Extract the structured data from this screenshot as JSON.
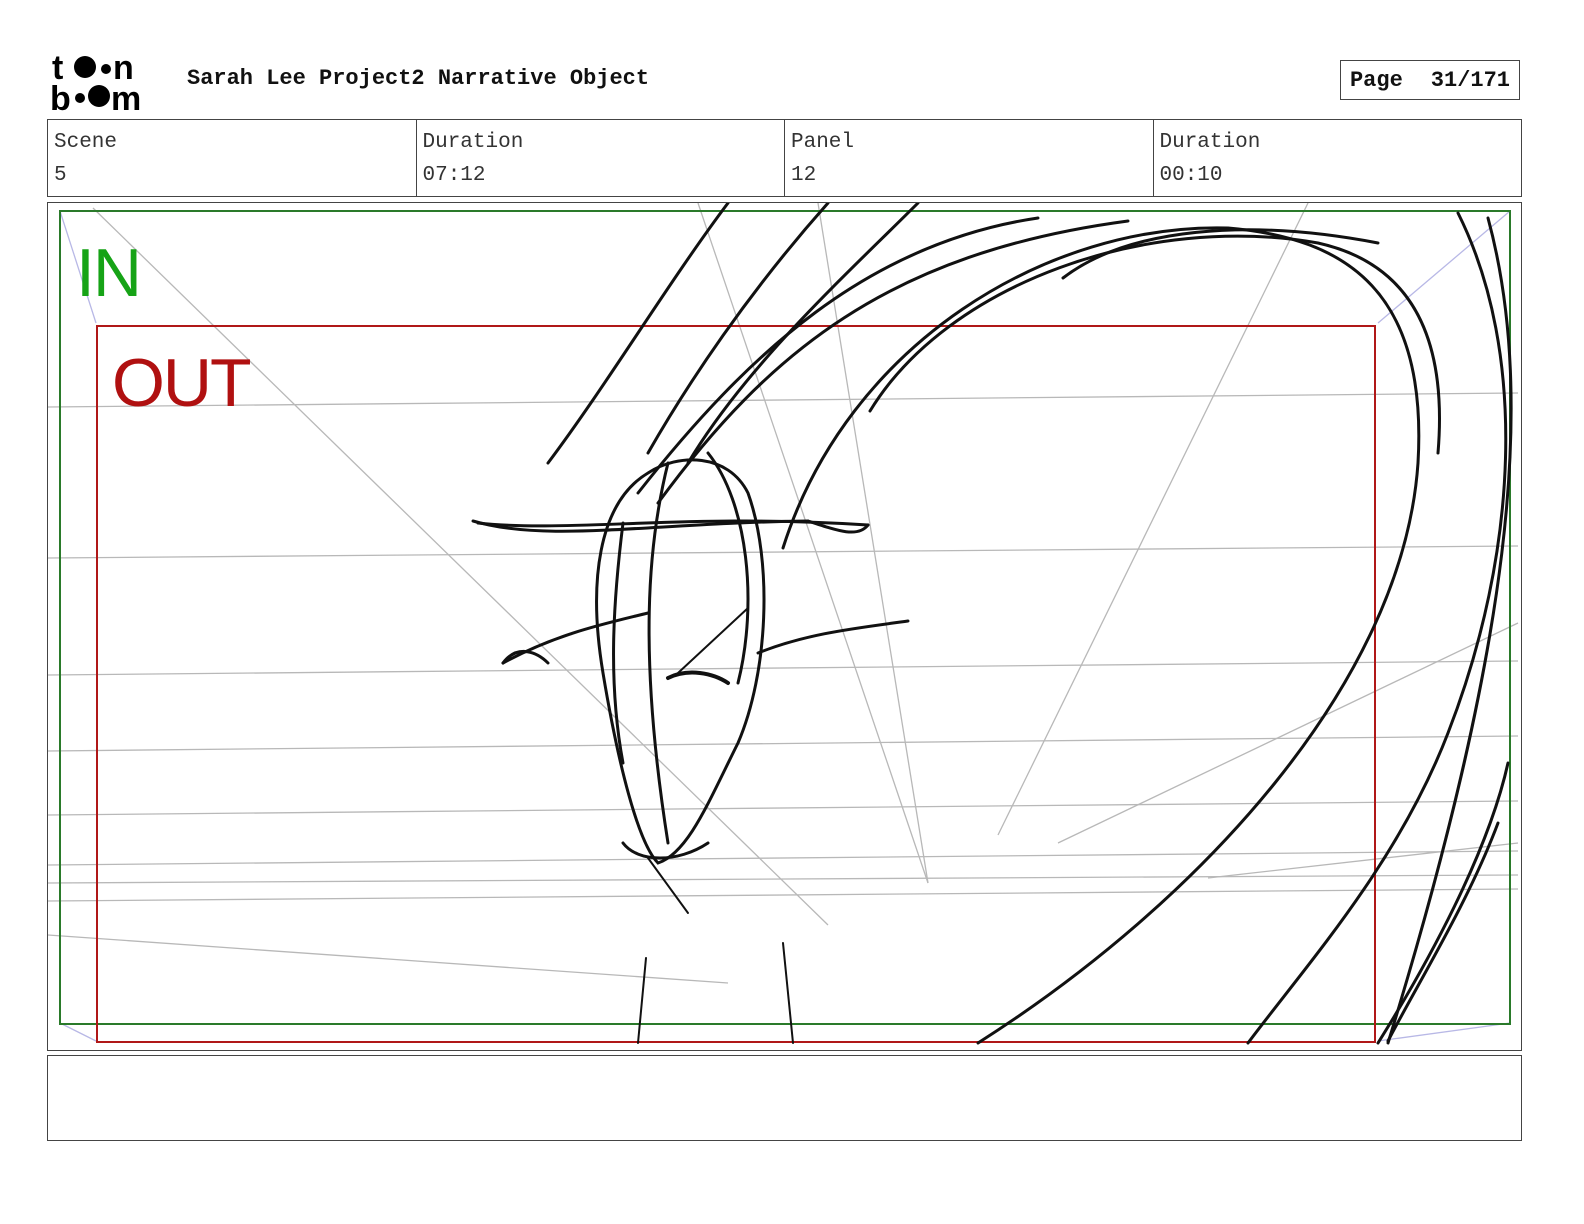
{
  "header": {
    "logo_text": "toon boom",
    "project_title": "Sarah Lee Project2 Narrative Object",
    "page_label": "Page",
    "page_value": "31/171"
  },
  "info": [
    {
      "label": "Scene",
      "value": "5"
    },
    {
      "label": "Duration",
      "value": "07:12"
    },
    {
      "label": "Panel",
      "value": "12"
    },
    {
      "label": "Duration",
      "value": "00:10"
    }
  ],
  "panel": {
    "in_label": "IN",
    "out_label": "OUT",
    "in_color": "#16a316",
    "out_color": "#b01010",
    "sketch_subject": "rough sketch of a long-necked creature with a horned head bending down"
  },
  "notes": {
    "text": ""
  }
}
